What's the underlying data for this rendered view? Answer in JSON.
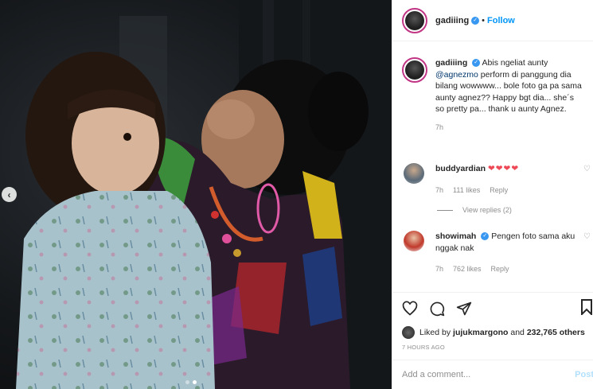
{
  "post": {
    "username": "gadiiing",
    "separator": "•",
    "follow_label": "Follow",
    "verified_icon": "✓"
  },
  "caption": {
    "username": "gadiiing",
    "text_before": "Abis ngeliat aunty",
    "mention": "@agnezmo",
    "text_after": "perform di panggung dia bilang wowwww... bole foto ga pa sama aunty agnez?? Happy bgt dia... she´s so pretty pa... thank u aunty Agnez.",
    "time": "7h"
  },
  "comments": [
    {
      "username": "buddyardian",
      "text": "❤❤❤❤",
      "time": "7h",
      "likes": "111 likes",
      "reply": "Reply",
      "view_replies": "View replies (2)"
    },
    {
      "username": "showimah",
      "text": "Pengen foto sama aku nggak nak",
      "time": "7h",
      "likes": "762 likes",
      "reply": "Reply"
    }
  ],
  "likes": {
    "prefix": "Liked by",
    "user": "jujukmargono",
    "middle": "and",
    "count": "232,765",
    "suffix": "others"
  },
  "posted_time": "7 HOURS AGO",
  "add_comment": {
    "placeholder": "Add a comment...",
    "post_label": "Post"
  },
  "carousel": {
    "prev_icon": "‹",
    "slide_count": 2,
    "active_slide": 2
  },
  "colors": {
    "accent": "#0095f6",
    "heart": "#ed4956",
    "muted": "#8e8e8e"
  }
}
